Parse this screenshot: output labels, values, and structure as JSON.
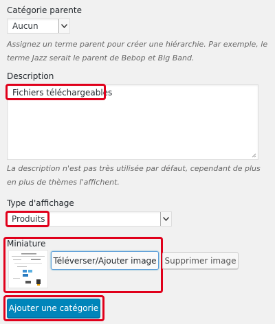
{
  "parent": {
    "label": "Catégorie parente",
    "selected": "Aucun",
    "help": "Assignez un terme parent pour créer une hiérarchie. Par exemple, le terme Jazz serait le parent de Bebop et Big Band."
  },
  "description": {
    "label": "Description",
    "value": "Fichiers téléchargeables",
    "help": "La description n'est pas très utilisée par défaut, cependant de plus en plus de thèmes l'affichent."
  },
  "display_type": {
    "label": "Type d'affichage",
    "selected": "Produits"
  },
  "thumbnail": {
    "label": "Miniature",
    "upload_label": "Téléverser/Ajouter image",
    "remove_label": "Supprimer image"
  },
  "submit": {
    "label": "Ajouter une catégorie"
  },
  "colors": {
    "highlight": "#e0001b",
    "primary": "#0085ba",
    "background": "#f1f1f1"
  }
}
